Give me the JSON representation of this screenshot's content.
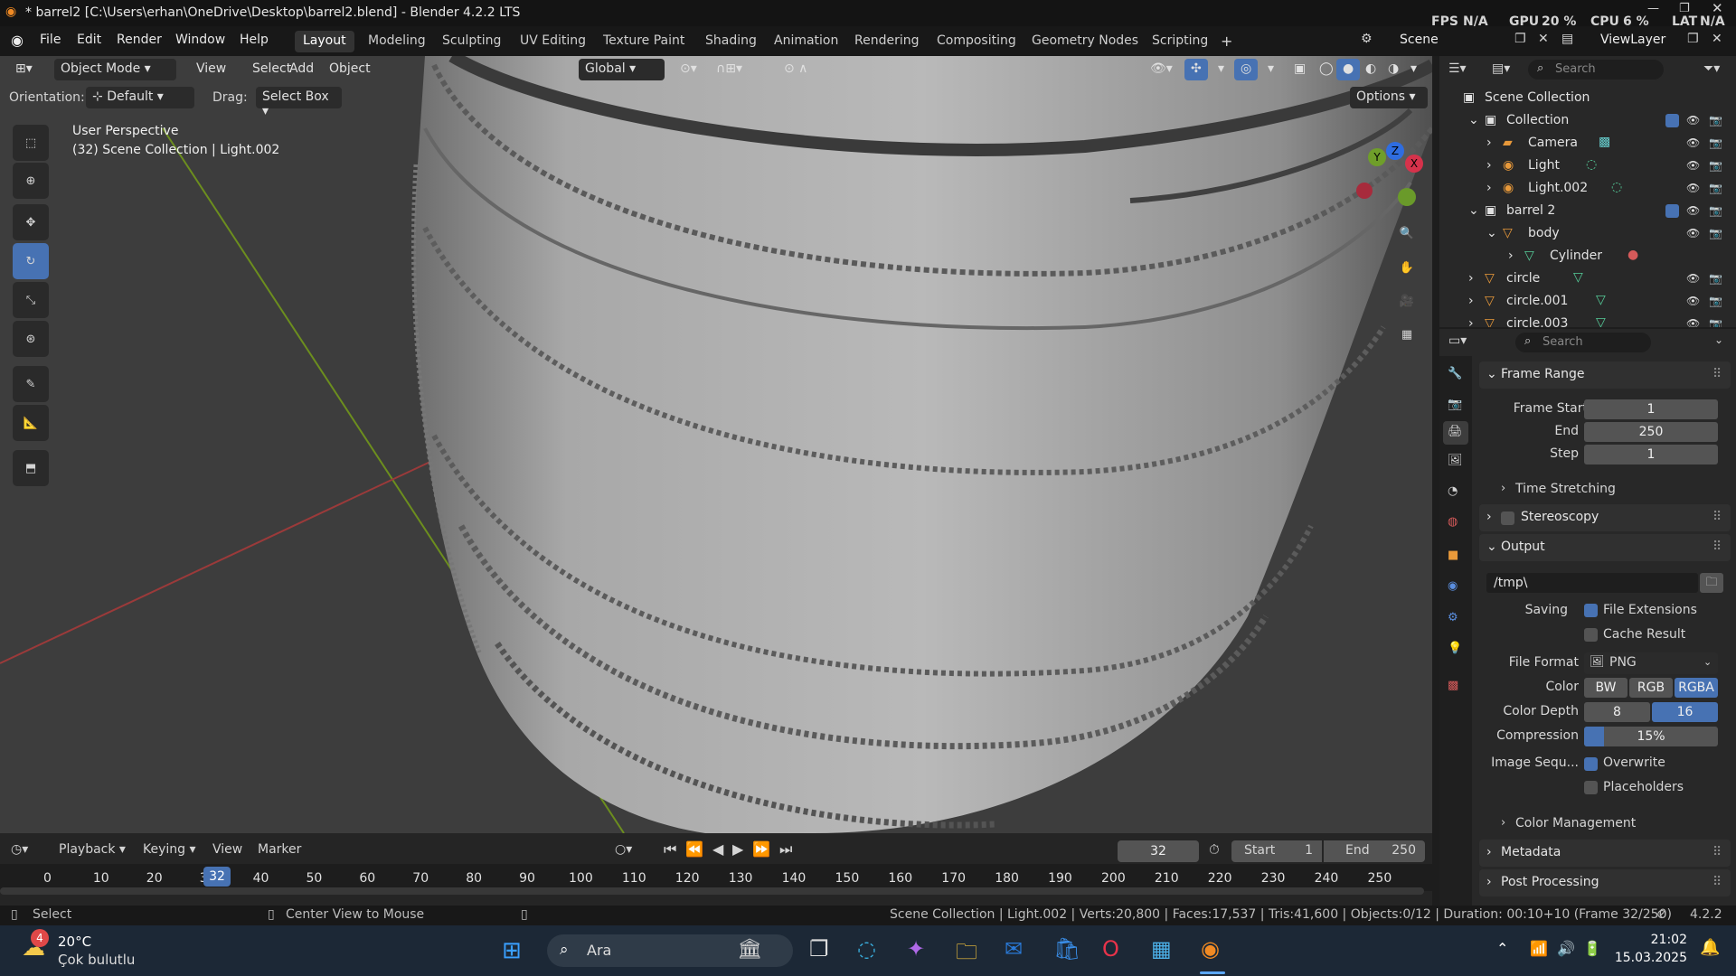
{
  "title": {
    "text": "* barrel2 [C:\\Users\\erhan\\OneDrive\\Desktop\\barrel2.blend] - Blender 4.2.2 LTS",
    "fps_label": "FPS",
    "fps_val": "N/A",
    "gpu_label": "GPU",
    "gpu_val": "20 %",
    "cpu_label": "CPU",
    "cpu_val": "6 %",
    "lat_label": "LAT",
    "lat_val": "N/A"
  },
  "menu": [
    "File",
    "Edit",
    "Render",
    "Window",
    "Help"
  ],
  "workspaces": [
    "Layout",
    "Modeling",
    "Sculpting",
    "UV Editing",
    "Texture Paint",
    "Shading",
    "Animation",
    "Rendering",
    "Compositing",
    "Geometry Nodes",
    "Scripting"
  ],
  "scene": "Scene",
  "viewlayer": "ViewLayer",
  "viewport": {
    "mode": "Object Mode",
    "menus": [
      "View",
      "Select",
      "Add",
      "Object"
    ],
    "transform": "Global",
    "orientation_label": "Orientation:",
    "orientation": "Default",
    "drag_label": "Drag:",
    "drag": "Select Box",
    "options": "Options",
    "persp": "User Perspective",
    "info": "(32) Scene Collection | Light.002"
  },
  "gizmo": {
    "x": "X",
    "y": "Y",
    "z": "Z"
  },
  "outliner": {
    "search": "Search",
    "root": "Scene Collection",
    "items": [
      "Collection",
      "Camera",
      "Light",
      "Light.002",
      "barrel 2",
      "body",
      "Cylinder",
      "circle",
      "circle.001",
      "circle.003"
    ]
  },
  "props": {
    "search": "Search",
    "frame_range": "Frame Range",
    "frame_start_l": "Frame Start",
    "frame_start": "1",
    "end_l": "End",
    "end": "250",
    "step_l": "Step",
    "step": "1",
    "time_stretching": "Time Stretching",
    "stereoscopy": "Stereoscopy",
    "output": "Output",
    "path": "/tmp\\",
    "saving": "Saving",
    "file_ext": "File Extensions",
    "cache": "Cache Result",
    "file_format_l": "File Format",
    "file_format": "PNG",
    "color_l": "Color",
    "bw": "BW",
    "rgb": "RGB",
    "rgba": "RGBA",
    "depth_l": "Color Depth",
    "d8": "8",
    "d16": "16",
    "compression_l": "Compression",
    "compression": "15%",
    "compression_level": 0.15,
    "imgseq_l": "Image Sequ...",
    "overwrite": "Overwrite",
    "placeholders": "Placeholders",
    "color_mgmt": "Color Management",
    "metadata": "Metadata",
    "post": "Post Processing"
  },
  "timeline": {
    "menus": [
      "Playback",
      "Keying",
      "View",
      "Marker"
    ],
    "frame": "32",
    "start_l": "Start",
    "start": "1",
    "end_l": "End",
    "end": "250",
    "ticks": [
      "0",
      "10",
      "20",
      "30",
      "40",
      "50",
      "60",
      "70",
      "80",
      "90",
      "100",
      "110",
      "120",
      "130",
      "140",
      "150",
      "160",
      "170",
      "180",
      "190",
      "200",
      "210",
      "220",
      "230",
      "240",
      "250"
    ],
    "current": "32"
  },
  "status": {
    "select": "Select",
    "center": "Center View to Mouse",
    "stats": "Scene Collection | Light.002 | Verts:20,800 | Faces:17,537 | Tris:41,600 | Objects:0/12 | Duration: 00:10+10 (Frame 32/250)",
    "version": "4.2.2"
  },
  "taskbar": {
    "temp": "20°C",
    "weather": "Çok bulutlu",
    "badge": "4",
    "search": "Ara",
    "time": "21:02",
    "date": "15.03.2025"
  }
}
